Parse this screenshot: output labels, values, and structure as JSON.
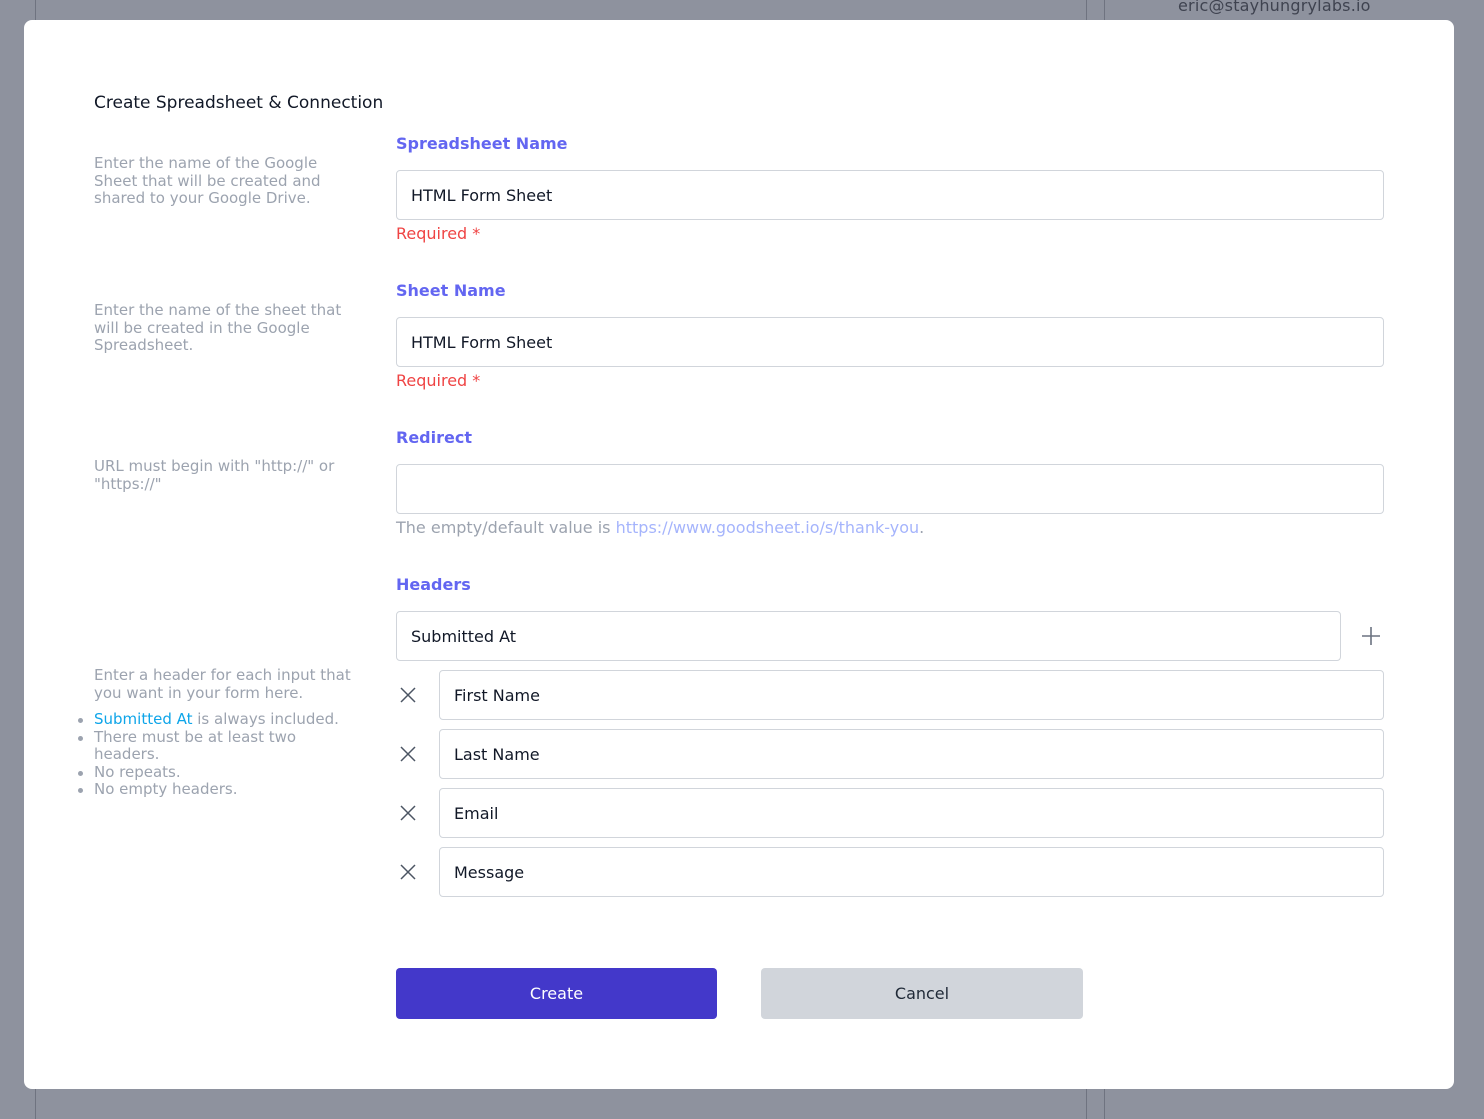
{
  "background": {
    "user_email": "eric@stayhungrylabs.io"
  },
  "modal": {
    "title": "Create Spreadsheet & Connection",
    "spreadsheet_name": {
      "help": "Enter the name of the Google Sheet that will be created and shared to your Google Drive.",
      "label": "Spreadsheet Name",
      "value": "HTML Form Sheet",
      "required_text": "Required *"
    },
    "sheet_name": {
      "help": "Enter the name of the sheet that will be created in the Google Spreadsheet.",
      "label": "Sheet Name",
      "value": "HTML Form Sheet",
      "required_text": "Required *"
    },
    "redirect": {
      "help": "URL must begin with \"http://\" or \"https://\"",
      "label": "Redirect",
      "value": "",
      "hint_prefix": "The empty/default value is ",
      "hint_link": "https://www.goodsheet.io/s/thank-you",
      "hint_suffix": "."
    },
    "headers": {
      "label": "Headers",
      "help": "Enter a header for each input that you want in your form here.",
      "rules_highlight": "Submitted At",
      "rules_first_suffix": " is always included.",
      "rules": [
        "There must be at least two headers.",
        "No repeats.",
        "No empty headers."
      ],
      "fixed_header": "Submitted At",
      "items": [
        "First Name",
        "Last Name",
        "Email",
        "Message"
      ]
    },
    "buttons": {
      "create": "Create",
      "cancel": "Cancel"
    },
    "colors": {
      "accent": "#6366f1",
      "primary_button": "#4338ca",
      "error": "#ef4444",
      "link": "#a5b4fc"
    }
  }
}
